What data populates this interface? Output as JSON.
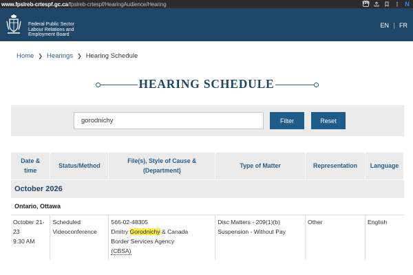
{
  "browser": {
    "url_domain": "www.fpslreb-crtespf.gc.ca",
    "url_path": "/fpslreb-crtespf/HearingAudience/Hearing",
    "vpn_label": "VPN",
    "n_label": "N"
  },
  "header": {
    "org_line1": "Federal Public Sector",
    "org_line2": "Labour Relations and",
    "org_line3": "Employment Board",
    "lang_en": "EN",
    "lang_fr": "FR"
  },
  "breadcrumb": {
    "home": "Home",
    "hearings": "Hearings",
    "current": "Hearing Schedule"
  },
  "page": {
    "title": "HEARING SCHEDULE"
  },
  "filter": {
    "search_value": "gorodnichy",
    "filter_label": "Filter",
    "reset_label": "Reset"
  },
  "table": {
    "columns": [
      {
        "line1": "Date &",
        "line2": "time"
      },
      {
        "line1": "Status/Method",
        "line2": ""
      },
      {
        "line1": "File(s), Style of Cause &",
        "line2": "(Department)"
      },
      {
        "line1": "Type of Matter",
        "line2": ""
      },
      {
        "line1": "Representation",
        "line2": ""
      },
      {
        "line1": "Language",
        "line2": ""
      }
    ],
    "month": "October 2026",
    "location": "Ontario, Ottawa",
    "row": {
      "date_line1": "October 21-",
      "date_line2": "23",
      "time": "9:30 AM",
      "status_line1": "Scheduled",
      "status_line2": "Videoconference",
      "file_number": "566-02-48305",
      "name_first": "Dmitry",
      "name_highlight": "Gorodnichy",
      "cause_rest": "& Canada",
      "cause_line2": "Border Services Agency",
      "dept": "(CBSA)",
      "matter_line1": "Disc Matters - 209(1)(b)",
      "matter_line2": "Suspension - Without Pay",
      "representation": "Other",
      "language": "English"
    }
  }
}
